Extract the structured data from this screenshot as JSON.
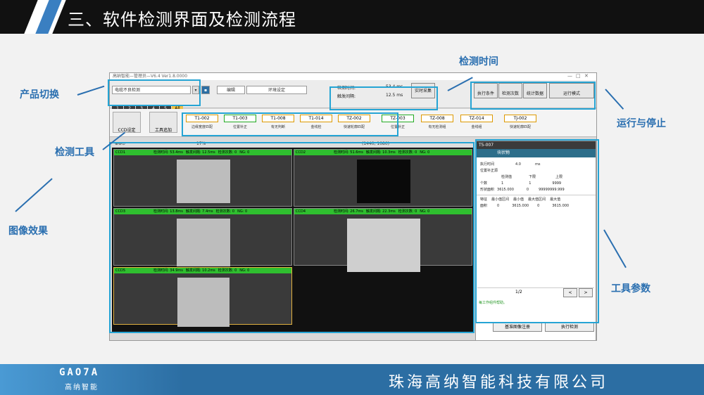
{
  "slide": {
    "title": "三、软件检测界面及检测流程",
    "footer_logo": "GAO7A",
    "footer_logo_cn": "高纳智能",
    "company": "珠海高纳智能科技有限公司"
  },
  "callouts": {
    "product_switch": "产品切换",
    "detect_time": "检测时间",
    "detect_tools": "检测工具",
    "run_stop": "运行与停止",
    "image_effect": "图像效果",
    "tool_params": "工具参数"
  },
  "colors": {
    "accent": "#2a6fb0",
    "highlight_box": "#25a4d4",
    "ccd_ok": "#2fbf2f"
  },
  "app": {
    "window_title": "高纳智能—管理员—V6.4 Ver1.8.0000",
    "product_select": "电缆不良检测",
    "menu_edit": "编辑",
    "menu_env": "环境设定",
    "detect_time_label": "检测时间:",
    "detect_time_value": "53.4 ms",
    "trigger_label": "触发间隔:",
    "trigger_value": "12.5 ms",
    "realtime_btn": "实时采集",
    "run_btn": "执行条件",
    "step_btn": "检测次数",
    "stat_btn": "统计数据",
    "mode_btn": "运行模式",
    "tabs": [
      "1",
      "2",
      "3",
      "4",
      "5",
      "All"
    ],
    "ccd_btn": "CCD设定",
    "tool_add_btn": "工具追加",
    "tools": [
      {
        "id": "T1-002",
        "name": "边缘宽度匹配",
        "type": "o"
      },
      {
        "id": "T1-003",
        "name": "位置补正",
        "type": "g"
      },
      {
        "id": "T1-008",
        "name": "有无判断",
        "type": "o"
      },
      {
        "id": "T1-014",
        "name": "金线检",
        "type": "o"
      },
      {
        "id": "TZ-002",
        "name": "快速轮廓匹配",
        "type": "o"
      },
      {
        "id": "TZ-003",
        "name": "位置补正",
        "type": "g"
      },
      {
        "id": "TZ-008",
        "name": "有无检测组",
        "type": "o"
      },
      {
        "id": "TZ-014",
        "name": "金线组",
        "type": "o"
      },
      {
        "id": "TJ-002",
        "name": "快速轮廓匹配",
        "type": "o"
      }
    ],
    "zoom": "17%",
    "resolution": "(1440, 1080)",
    "ccds": [
      {
        "name": "CCD1",
        "detect": "检测时间:  53.4ms",
        "trigger": "触发间隔:  12.5ms",
        "count": "检测次数:  0",
        "ng": "NG: 0"
      },
      {
        "name": "CCD2",
        "detect": "检测时间:  51.6ms",
        "trigger": "触发间隔:  10.3ms",
        "count": "检测次数:  0",
        "ng": "NG: 0"
      },
      {
        "name": "CCD3",
        "detect": "检测时间:  13.8ms",
        "trigger": "触发间隔:  7.4ms",
        "count": "检测次数:  0",
        "ng": "NG: 0"
      },
      {
        "name": "CCD4",
        "detect": "检测时间:  26.7ms",
        "trigger": "触发间隔:  22.3ms",
        "count": "检测次数:  0",
        "ng": "NG: 0"
      },
      {
        "name": "CCD5",
        "detect": "检测时间:  34.9ms",
        "trigger": "触发间隔:  10.2ms",
        "count": "检测次数:  0",
        "ng": "NG: 0"
      }
    ],
    "panel": {
      "header": "T5-007",
      "sub": "块状物",
      "exec_time_label": "执行时间",
      "exec_time_value": "4.0",
      "exec_time_unit": "ms",
      "pos_fix": "位置补正源",
      "row_head": [
        "检测值",
        "下限",
        "上限"
      ],
      "row1": [
        "个数",
        "1",
        "1",
        "9999"
      ],
      "row2": [
        "形状面积",
        "3615.000",
        "0",
        "99999999.999"
      ],
      "stats_head": [
        "特征",
        "最小值区间",
        "最小值",
        "最大值区间",
        "最大值"
      ],
      "stats_row": [
        "面积",
        "0",
        "3615.000",
        "0",
        "3615.000"
      ],
      "page": "1/2",
      "prev": "<",
      "next": ">",
      "note": "每工作组件帮助。",
      "base_btn": "基准图像注册",
      "exec_btn": "执行检测"
    }
  }
}
